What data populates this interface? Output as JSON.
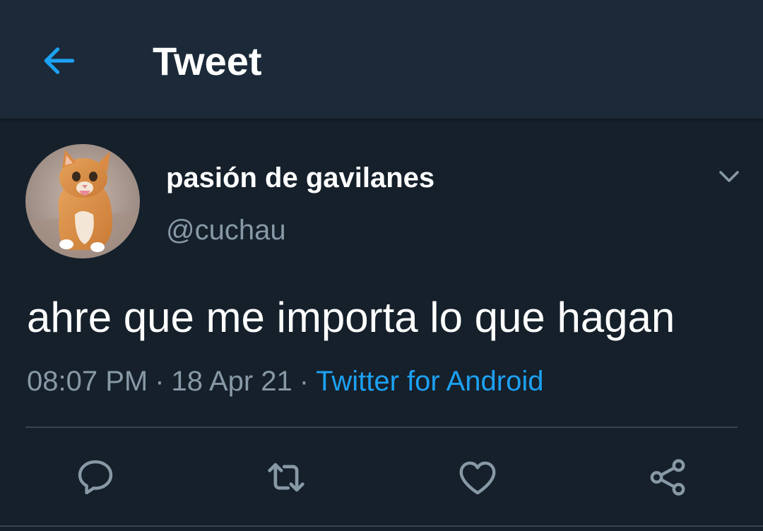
{
  "header": {
    "title": "Tweet",
    "back_icon": "arrow-left-icon",
    "accent_color": "#1da1f2"
  },
  "tweet": {
    "display_name": "pasión de gavilanes",
    "handle": "@cuchau",
    "avatar": "cat-photo-avatar",
    "text": "ahre que me importa lo que hagan",
    "time": "08:07 PM",
    "date": "18 Apr 21",
    "source": "Twitter for Android",
    "separator": "·"
  },
  "actions": [
    {
      "name": "reply",
      "icon": "reply-icon"
    },
    {
      "name": "retweet",
      "icon": "retweet-icon"
    },
    {
      "name": "like",
      "icon": "heart-icon"
    },
    {
      "name": "share",
      "icon": "share-icon"
    }
  ],
  "colors": {
    "background": "#15202b",
    "header_bg": "#1c2938",
    "secondary_text": "#8899a6",
    "link": "#1da1f2",
    "divider": "#38444d"
  }
}
